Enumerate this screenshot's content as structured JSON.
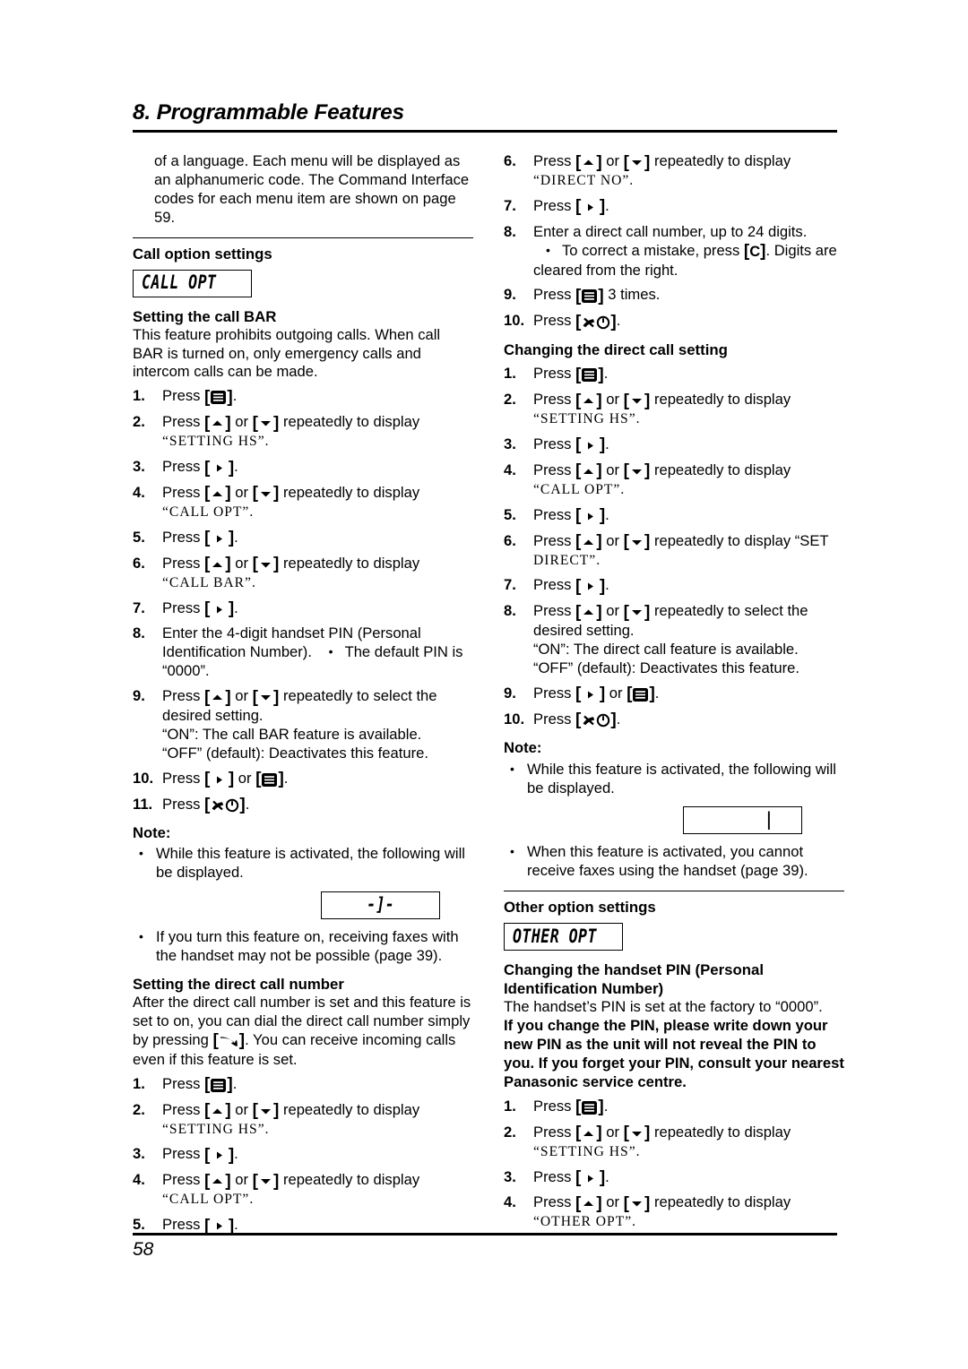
{
  "header": {
    "chapter": "8. Programmable Features"
  },
  "footer": {
    "page_number": "58"
  },
  "left_column": {
    "intro_paragraph": "of a language. Each menu will be displayed as an alphanumeric code. The Command Interface codes for each menu item are shown on page 59.",
    "call_option": {
      "section_title": "Call option settings",
      "lcd_label": "CALL OPT",
      "call_bar": {
        "title": "Setting the call BAR",
        "description": "This feature prohibits outgoing calls. When call BAR is turned on, only emergency calls and intercom calls can be made.",
        "steps": [
          {
            "num": "1.",
            "pre": "Press ",
            "key": "menu",
            "post": "."
          },
          {
            "num": "2.",
            "pre": "Press ",
            "key": "updown",
            "post": " repeatedly to display",
            "code_line": "“SETTING HS”."
          },
          {
            "num": "3.",
            "pre": "Press ",
            "key": "right",
            "post": "."
          },
          {
            "num": "4.",
            "pre": "Press ",
            "key": "updown",
            "post": " repeatedly to display",
            "code_line": "“CALL OPT”."
          },
          {
            "num": "5.",
            "pre": "Press ",
            "key": "right",
            "post": "."
          },
          {
            "num": "6.",
            "pre": "Press ",
            "key": "updown",
            "post": " repeatedly to display",
            "code_line": "“CALL BAR”."
          },
          {
            "num": "7.",
            "pre": "Press ",
            "key": "right",
            "post": "."
          },
          {
            "num": "8.",
            "plain": "Enter the 4-digit handset PIN (Personal Identification Number).",
            "bullet": "The default PIN is “0000”."
          },
          {
            "num": "9.",
            "pre": "Press ",
            "key": "updown",
            "post": " repeatedly to select the desired setting.",
            "extra_lines": [
              "“ON”: The call BAR feature is available.",
              "“OFF” (default): Deactivates this feature."
            ]
          },
          {
            "num": "10.",
            "pre": "Press ",
            "key": "right-or-menu",
            "post": "."
          },
          {
            "num": "11.",
            "pre": "Press ",
            "key": "off",
            "post": "."
          }
        ],
        "note_label": "Note:",
        "note_items": [
          "While this feature is activated, the following will be displayed.",
          "If you turn this feature on, receiving faxes with the handset may not be possible (page 39)."
        ],
        "note_lcd_glyph": "call-bar-indicator"
      },
      "direct_call_number": {
        "title": "Setting the direct call number",
        "description_pre": "After the direct call number is set and this feature is set to on, you can dial the direct call number simply by pressing ",
        "description_post": ". You can receive incoming calls even if this feature is set.",
        "steps": [
          {
            "num": "1.",
            "pre": "Press ",
            "key": "menu",
            "post": "."
          },
          {
            "num": "2.",
            "pre": "Press ",
            "key": "updown",
            "post": " repeatedly to display",
            "code_line": "“SETTING HS”."
          },
          {
            "num": "3.",
            "pre": "Press ",
            "key": "right",
            "post": "."
          },
          {
            "num": "4.",
            "pre": "Press ",
            "key": "updown",
            "post": " repeatedly to display",
            "code_line": "“CALL OPT”."
          },
          {
            "num": "5.",
            "pre": "Press ",
            "key": "right",
            "post": "."
          }
        ]
      }
    }
  },
  "right_column": {
    "direct_call_number_cont": {
      "steps": [
        {
          "num": "6.",
          "pre": "Press ",
          "key": "updown",
          "post": " repeatedly to display",
          "code_line": "“DIRECT NO”."
        },
        {
          "num": "7.",
          "pre": "Press ",
          "key": "right",
          "post": "."
        },
        {
          "num": "8.",
          "plain": "Enter a direct call number, up to 24 digits.",
          "bullet_pre": "To correct a mistake, press ",
          "bullet_key": "C",
          "bullet_post": ". Digits are cleared from the right."
        },
        {
          "num": "9.",
          "pre": "Press ",
          "key": "menu",
          "post": " 3 times."
        },
        {
          "num": "10.",
          "pre": "Press ",
          "key": "off",
          "post": "."
        }
      ]
    },
    "direct_call_setting": {
      "title": "Changing the direct call setting",
      "steps": [
        {
          "num": "1.",
          "pre": "Press ",
          "key": "menu",
          "post": "."
        },
        {
          "num": "2.",
          "pre": "Press ",
          "key": "updown",
          "post": " repeatedly to display",
          "code_line": "“SETTING HS”."
        },
        {
          "num": "3.",
          "pre": "Press ",
          "key": "right",
          "post": "."
        },
        {
          "num": "4.",
          "pre": "Press ",
          "key": "updown",
          "post": " repeatedly to display",
          "code_line": "“CALL OPT”."
        },
        {
          "num": "5.",
          "pre": "Press ",
          "key": "right",
          "post": "."
        },
        {
          "num": "6.",
          "pre": "Press ",
          "key": "updown",
          "post": " repeatedly to display “SET",
          "code_line": "DIRECT”.",
          "inline_code": true
        },
        {
          "num": "7.",
          "pre": "Press ",
          "key": "right",
          "post": "."
        },
        {
          "num": "8.",
          "pre": "Press ",
          "key": "updown",
          "post": " repeatedly to select the desired setting.",
          "extra_lines": [
            "“ON”: The direct call feature is available.",
            "“OFF” (default): Deactivates this feature."
          ]
        },
        {
          "num": "9.",
          "pre": "Press ",
          "key": "right-or-menu",
          "post": "."
        },
        {
          "num": "10.",
          "pre": "Press ",
          "key": "off",
          "post": "."
        }
      ],
      "note_label": "Note:",
      "note_items": [
        "While this feature is activated, the following will be displayed.",
        "When this feature is activated, you cannot receive faxes using the handset (page 39)."
      ],
      "note_lcd_glyph": "direct-call-indicator"
    },
    "other_option": {
      "section_title": "Other option settings",
      "lcd_label": "OTHER OPT",
      "handset_pin": {
        "title_line1": "Changing the handset PIN (Personal",
        "title_line2": "Identification Number)",
        "description": "The handset’s PIN is set at the factory to “0000”.",
        "warning": "If you change the PIN, please write down your new PIN as the unit will not reveal the PIN to you. If you forget your PIN, consult your nearest Panasonic service centre.",
        "steps": [
          {
            "num": "1.",
            "pre": "Press ",
            "key": "menu",
            "post": "."
          },
          {
            "num": "2.",
            "pre": "Press ",
            "key": "updown",
            "post": " repeatedly to display",
            "code_line": "“SETTING HS”."
          },
          {
            "num": "3.",
            "pre": "Press ",
            "key": "right",
            "post": "."
          },
          {
            "num": "4.",
            "pre": "Press ",
            "key": "updown",
            "post": " repeatedly to display",
            "code_line": "“OTHER OPT”."
          }
        ]
      }
    }
  },
  "icons": {
    "menu": "menu-key-icon",
    "up": "up-arrow-key-icon",
    "down": "down-arrow-key-icon",
    "right": "right-arrow-key-icon",
    "off": "phone-off-key-icon",
    "talk": "talk-key-icon",
    "clear": "clear-key-icon"
  },
  "colors": {
    "text": "#000000",
    "background": "#ffffff",
    "rule": "#000000"
  }
}
